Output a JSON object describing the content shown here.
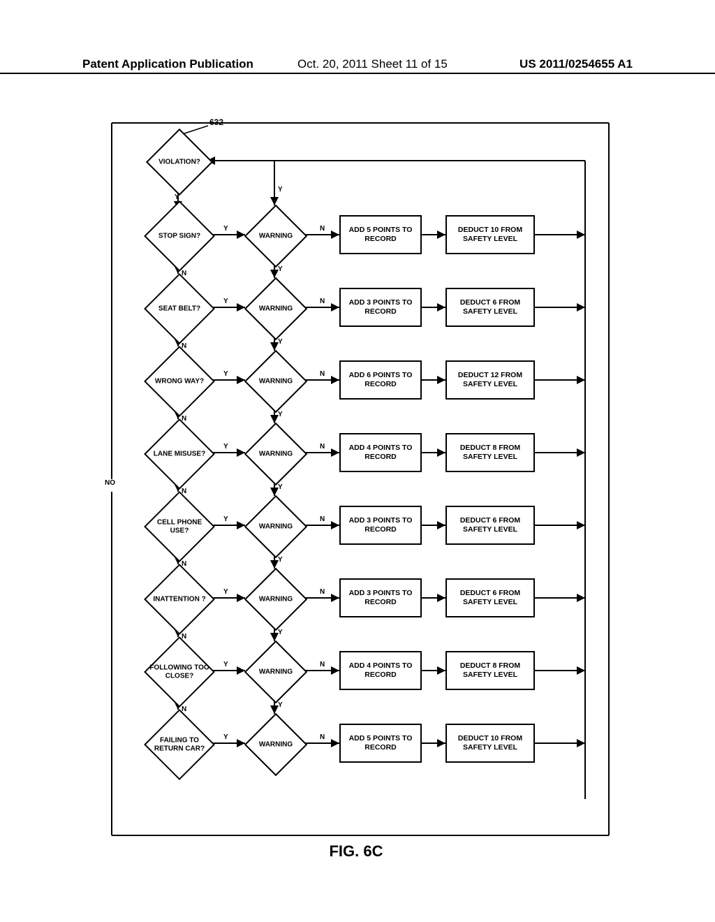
{
  "header": {
    "left": "Patent Application Publication",
    "center": "Oct. 20, 2011  Sheet 11 of 15",
    "right": "US 2011/0254655 A1"
  },
  "figure_label": "FIG. 6C",
  "ref_num": "632",
  "no_label": "NO",
  "violation": "VIOLATION?",
  "rows": [
    {
      "condition": "STOP SIGN?",
      "warning": "WARNING",
      "points": "ADD 5 POINTS TO RECORD",
      "deduct": "DEDUCT 10 FROM SAFETY LEVEL"
    },
    {
      "condition": "SEAT BELT?",
      "warning": "WARNING",
      "points": "ADD 3 POINTS TO RECORD",
      "deduct": "DEDUCT 6 FROM SAFETY LEVEL"
    },
    {
      "condition": "WRONG WAY?",
      "warning": "WARNING",
      "points": "ADD 6 POINTS TO RECORD",
      "deduct": "DEDUCT 12 FROM SAFETY LEVEL"
    },
    {
      "condition": "LANE MISUSE?",
      "warning": "WARNING",
      "points": "ADD 4 POINTS TO RECORD",
      "deduct": "DEDUCT 8 FROM SAFETY LEVEL"
    },
    {
      "condition": "CELL PHONE USE?",
      "warning": "WARNING",
      "points": "ADD 3 POINTS TO RECORD",
      "deduct": "DEDUCT 6 FROM SAFETY LEVEL"
    },
    {
      "condition": "INATTENTION ?",
      "warning": "WARNING",
      "points": "ADD 3 POINTS TO RECORD",
      "deduct": "DEDUCT 6 FROM SAFETY LEVEL"
    },
    {
      "condition": "FOLLOWING TOO CLOSE?",
      "warning": "WARNING",
      "points": "ADD 4 POINTS TO RECORD",
      "deduct": "DEDUCT 8 FROM SAFETY LEVEL"
    },
    {
      "condition": "FAILING TO RETURN CAR?",
      "warning": "WARNING",
      "points": "ADD 5 POINTS TO RECORD",
      "deduct": "DEDUCT 10 FROM SAFETY LEVEL"
    }
  ],
  "edges": {
    "y": "Y",
    "n": "N"
  }
}
